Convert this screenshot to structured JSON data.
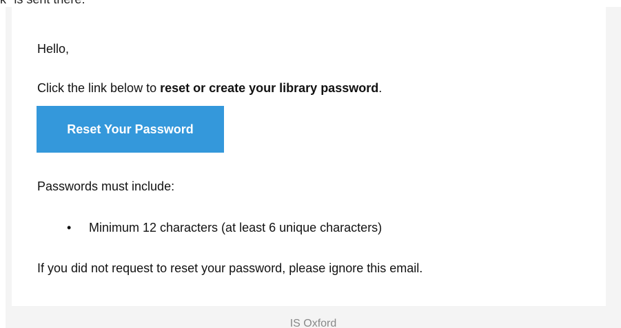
{
  "header_fragment": "k\" is sent there.",
  "email": {
    "greeting": "Hello,",
    "intro_prefix": "Click the link below to ",
    "intro_bold": "reset or create your library password",
    "intro_suffix": ".",
    "button_label": "Reset Your Password",
    "requirements_heading": "Passwords must include:",
    "requirements": [
      "Minimum 12 characters (at least 6 unique characters)"
    ],
    "closing": "If you did not request to reset your password, please ignore this email.",
    "footer": "IS Oxford"
  },
  "colors": {
    "button_bg": "#3498db",
    "button_text": "#ffffff",
    "frame_bg": "#f4f4f4",
    "footer_text": "#888888"
  },
  "icons": {
    "bullet": "bullet-dot"
  }
}
